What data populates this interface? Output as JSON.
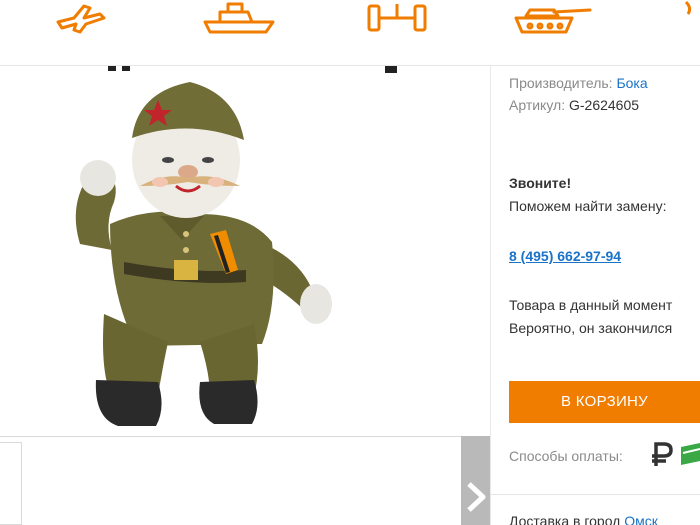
{
  "category_icons": [
    "airplane-icon",
    "boat-icon",
    "walker-icon",
    "tank-icon",
    "partial-icon"
  ],
  "product": {
    "image_alt": "soldier-doll",
    "manufacturer_label": "Производитель:",
    "manufacturer_value": "Бока",
    "article_label": "Артикул:",
    "article_value": "G-2624605",
    "call_title": "Звоните!",
    "call_text": "Поможем найти замену:",
    "phone": "8 (495) 662-97-94",
    "unavailable_line1": "Товара в данный момент",
    "unavailable_line2": "Вероятно, он закончился",
    "buy_label": "В КОРЗИНУ",
    "payment_label": "Способы оплаты:",
    "delivery_label": "Доставка в город",
    "delivery_city": "Омск"
  },
  "colors": {
    "accent": "#f07d00",
    "link": "#1a73c8",
    "muted": "#8a8a8a"
  }
}
